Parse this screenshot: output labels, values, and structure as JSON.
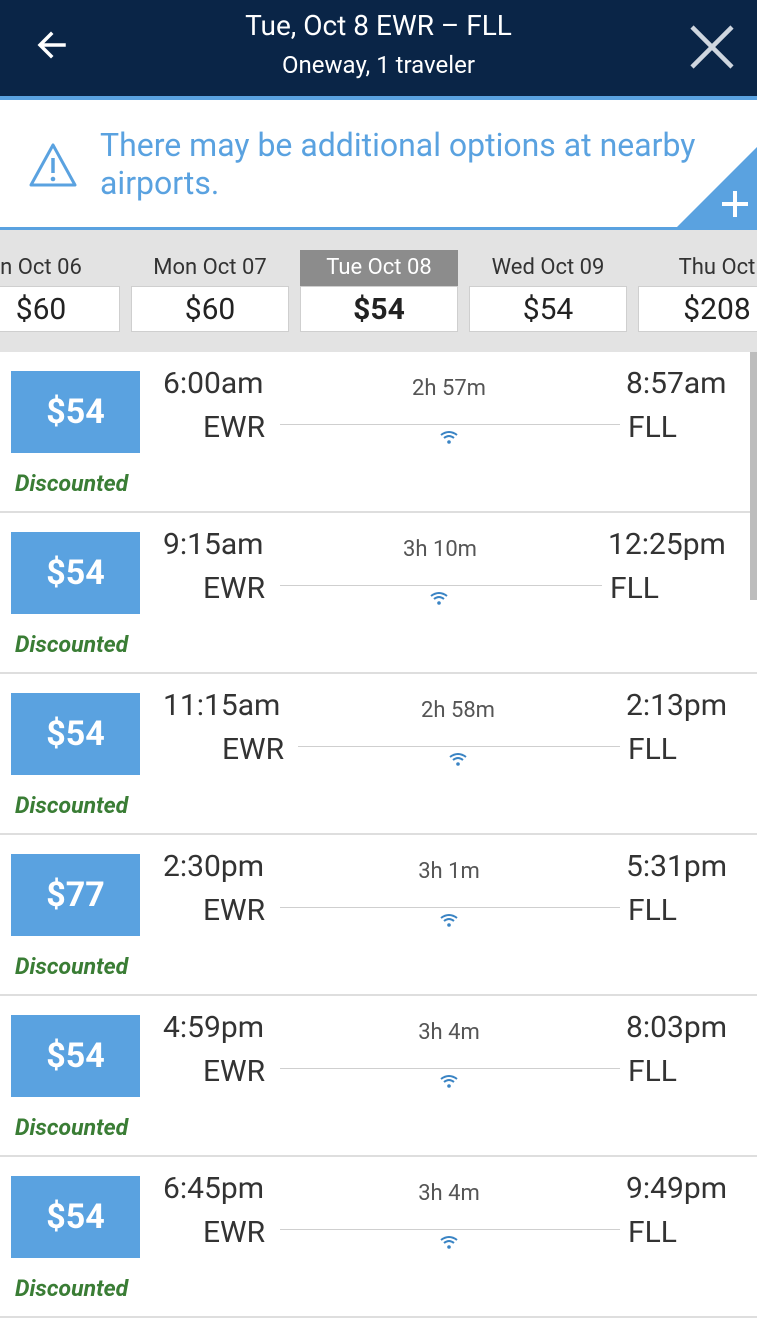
{
  "header": {
    "title": "Tue, Oct 8 EWR – FLL",
    "subtitle": "Oneway, 1 traveler",
    "back_icon": "arrow-left-icon",
    "close_icon": "close-icon"
  },
  "notice": {
    "message": "There may be additional options at nearby airports.",
    "icon": "warning-triangle-icon",
    "expand_icon": "plus-icon"
  },
  "dates": [
    {
      "label": "n Oct 06",
      "price": "$60"
    },
    {
      "label": "Mon Oct 07",
      "price": "$60"
    },
    {
      "label": "Tue Oct 08",
      "price": "$54",
      "selected": true
    },
    {
      "label": "Wed Oct 09",
      "price": "$54"
    },
    {
      "label": "Thu Oct",
      "price": "$208"
    }
  ],
  "flights": [
    {
      "price": "$54",
      "tag": "Discounted",
      "dep_time": "6:00am",
      "dep_code": "EWR",
      "duration": "2h 57m",
      "arr_time": "8:57am",
      "arr_code": "FLL"
    },
    {
      "price": "$54",
      "tag": "Discounted",
      "dep_time": "9:15am",
      "dep_code": "EWR",
      "duration": "3h 10m",
      "arr_time": "12:25pm",
      "arr_code": "FLL"
    },
    {
      "price": "$54",
      "tag": "Discounted",
      "dep_time": "11:15am",
      "dep_code": "EWR",
      "duration": "2h 58m",
      "arr_time": "2:13pm",
      "arr_code": "FLL"
    },
    {
      "price": "$77",
      "tag": "Discounted",
      "dep_time": "2:30pm",
      "dep_code": "EWR",
      "duration": "3h 1m",
      "arr_time": "5:31pm",
      "arr_code": "FLL"
    },
    {
      "price": "$54",
      "tag": "Discounted",
      "dep_time": "4:59pm",
      "dep_code": "EWR",
      "duration": "3h 4m",
      "arr_time": "8:03pm",
      "arr_code": "FLL"
    },
    {
      "price": "$54",
      "tag": "Discounted",
      "dep_time": "6:45pm",
      "dep_code": "EWR",
      "duration": "3h 4m",
      "arr_time": "9:49pm",
      "arr_code": "FLL"
    }
  ],
  "colors": {
    "header_bg": "#0a2547",
    "accent": "#5aa2e0",
    "discount_green": "#3a7d35",
    "selected_date_bg": "#8c8c8c"
  }
}
